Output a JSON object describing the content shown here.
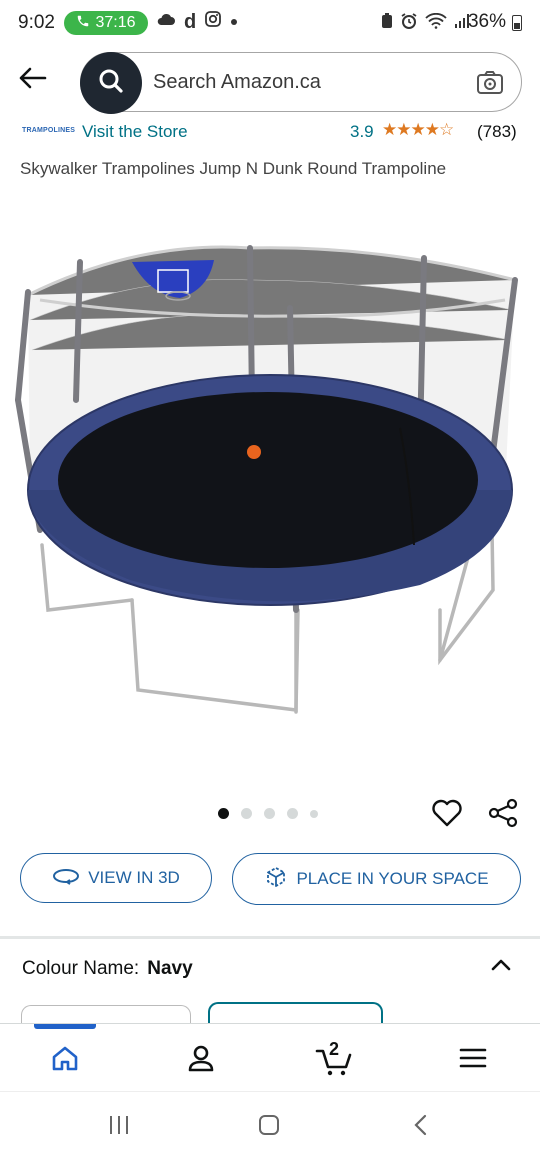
{
  "status_bar": {
    "time": "9:02",
    "call_timer": "37:16",
    "battery": "36%"
  },
  "search": {
    "placeholder": "Search Amazon.ca"
  },
  "store": {
    "logo_text": "TRAMPOLINES",
    "visit_label": "Visit the Store",
    "rating": "3.9",
    "stars": "★★★★☆",
    "rating_count": "(783)"
  },
  "product": {
    "title": "Skywalker Trampolines Jump N Dunk Round Trampoline"
  },
  "carousel": {
    "total_dots": 5,
    "active_index": 0
  },
  "actions": {
    "view_3d": "VIEW IN 3D",
    "place_in_space": "PLACE IN YOUR SPACE"
  },
  "colour": {
    "label": "Colour Name:",
    "value": "Navy"
  },
  "bottom_nav": {
    "cart_count": "2",
    "items": [
      "home-icon",
      "account-icon",
      "cart-icon",
      "menu-icon"
    ]
  },
  "colors": {
    "accent_link": "#007185",
    "button_blue": "#2162a1",
    "star_orange": "#de7921",
    "call_green": "#3cb54a",
    "trampoline_navy": "#3b4a86"
  }
}
